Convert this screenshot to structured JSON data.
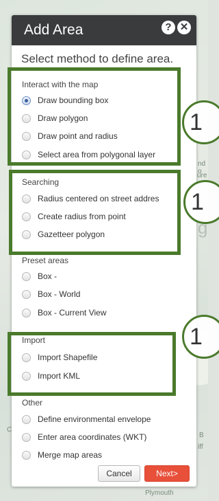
{
  "dialog": {
    "title": "Add Area",
    "help_icon": "?",
    "close_icon": "✕",
    "subtitle": "Select method to define area."
  },
  "sections": [
    {
      "label": "Interact with the map",
      "options": [
        {
          "label": "Draw bounding box",
          "checked": true
        },
        {
          "label": "Draw polygon",
          "checked": false
        },
        {
          "label": "Draw point and radius",
          "checked": false
        },
        {
          "label": "Select area from polygonal layer",
          "checked": false
        }
      ]
    },
    {
      "label": "Searching",
      "options": [
        {
          "label": "Radius centered on street addres",
          "checked": false
        },
        {
          "label": "Create radius from point",
          "checked": false
        },
        {
          "label": "Gazetteer polygon",
          "checked": false
        }
      ]
    },
    {
      "label": "Preset areas",
      "options": [
        {
          "label": "Box -",
          "checked": false
        },
        {
          "label": "Box - World",
          "checked": false
        },
        {
          "label": "Box - Current View",
          "checked": false
        }
      ]
    },
    {
      "label": "Import",
      "options": [
        {
          "label": "Import Shapefile",
          "checked": false
        },
        {
          "label": "Import KML",
          "checked": false
        }
      ]
    },
    {
      "label": "Other",
      "options": [
        {
          "label": "Define environmental envelope",
          "checked": false
        },
        {
          "label": "Enter area coordinates (WKT)",
          "checked": false
        },
        {
          "label": "Merge map areas",
          "checked": false
        }
      ]
    }
  ],
  "buttons": {
    "cancel": "Cancel",
    "next": "Next>"
  },
  "annotations": {
    "marker_1": "1",
    "marker_2": "1",
    "marker_3": "1"
  },
  "map": {
    "label_1": "nd",
    "label_2": "o",
    "label_3": "ure",
    "label_4": "g",
    "label_5": "B",
    "label_6": "iff",
    "label_7": "C",
    "label_8": "Plymouth"
  },
  "colors": {
    "titlebar": "#3a3b3d",
    "next_button": "#e8503a",
    "annotation": "#4a7a2b"
  }
}
